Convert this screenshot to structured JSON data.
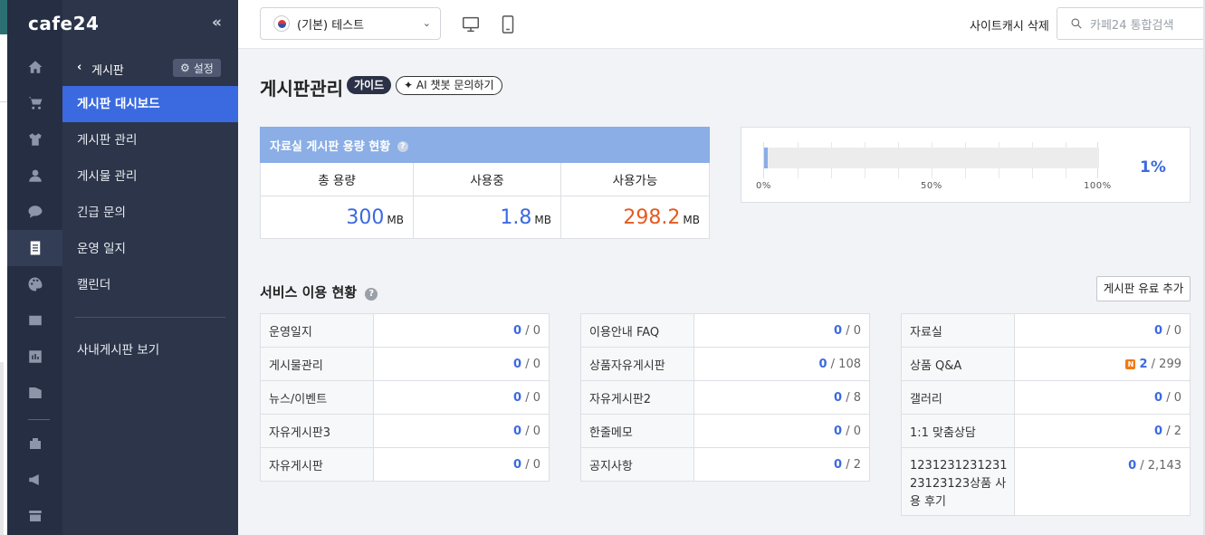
{
  "brand": {
    "logo_text": "cafe24"
  },
  "rail": {
    "icons": [
      "home-icon",
      "cart-icon",
      "shirt-icon",
      "user-icon",
      "chat-icon",
      "board-icon",
      "palette-icon",
      "promotion-icon",
      "stats-icon",
      "channel-icon",
      "apps-icon",
      "megaphone-icon",
      "store-icon"
    ]
  },
  "panel": {
    "back_label": "게시판",
    "setting_label": "설정",
    "items": [
      {
        "label": "게시판 대시보드",
        "active": true
      },
      {
        "label": "게시판 관리"
      },
      {
        "label": "게시물 관리"
      },
      {
        "label": "긴급 문의"
      },
      {
        "label": "운영 일지"
      },
      {
        "label": "캘린더"
      }
    ],
    "extra_link": "사내게시판 보기"
  },
  "topbar": {
    "shop_name": "(기본) 테스트",
    "cache_delete": "사이트캐시 삭제",
    "search_placeholder": "카페24 통합검색"
  },
  "page": {
    "title": "게시판관리",
    "guide_badge": "가이드",
    "ai_badge": "AI 챗봇 문의하기"
  },
  "storage": {
    "title": "자료실 게시판 용량 현황",
    "help": "?",
    "headers": [
      "총 용량",
      "사용중",
      "사용가능"
    ],
    "total": "300",
    "used": "1.8",
    "available": "298.2",
    "unit": "MB"
  },
  "usage": {
    "percent_label": "1%",
    "percent_value": 1,
    "ticks": [
      "0%",
      "50%",
      "100%"
    ]
  },
  "services": {
    "title": "서비스 이용 현황",
    "help": "?",
    "add_button": "게시판 유료 추가",
    "columns": [
      [
        {
          "name": "운영일지",
          "current": "0",
          "total": "/ 0"
        },
        {
          "name": "게시물관리",
          "current": "0",
          "total": "/ 0"
        },
        {
          "name": "뉴스/이벤트",
          "current": "0",
          "total": "/ 0"
        },
        {
          "name": "자유게시판3",
          "current": "0",
          "total": "/ 0"
        },
        {
          "name": "자유게시판",
          "current": "0",
          "total": "/ 0"
        }
      ],
      [
        {
          "name": "이용안내 FAQ",
          "current": "0",
          "total": "/ 0"
        },
        {
          "name": "상품자유게시판",
          "current": "0",
          "total": "/ 108"
        },
        {
          "name": "자유게시판2",
          "current": "0",
          "total": "/ 8"
        },
        {
          "name": "한줄메모",
          "current": "0",
          "total": "/ 0"
        },
        {
          "name": "공지사항",
          "current": "0",
          "total": "/ 2"
        }
      ],
      [
        {
          "name": "자료실",
          "current": "0",
          "total": "/ 0"
        },
        {
          "name": "상품 Q&A",
          "current": "2",
          "total": "/ 299",
          "badge": "N"
        },
        {
          "name": "갤러리",
          "current": "0",
          "total": "/ 0"
        },
        {
          "name": "1:1 맞춤상담",
          "current": "0",
          "total": "/ 2"
        },
        {
          "name": "123123123123123123123상품 사용 후기",
          "current": "0",
          "total": "/ 2,143"
        }
      ]
    ]
  },
  "colors": {
    "sidebar_rail": "#252e42",
    "sidebar_panel": "#2c3549",
    "active_item": "#3b6ae0",
    "accent_blue": "#3b6ae0",
    "accent_orange": "#e65a1f",
    "storage_header": "#8aaee5"
  }
}
